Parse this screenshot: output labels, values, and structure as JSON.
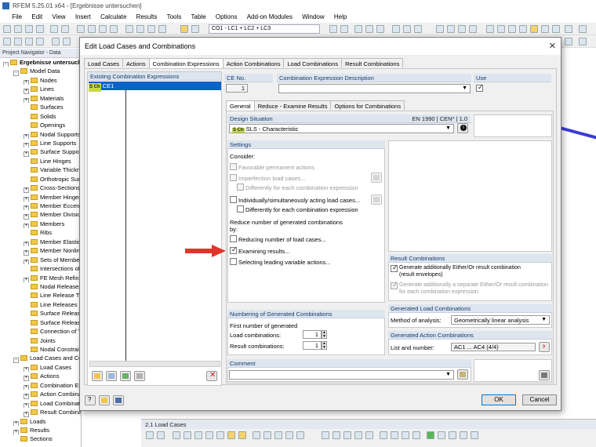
{
  "app": {
    "title": "RFEM 5.25.01 x64 - [Ergebnisse untersuchen]"
  },
  "menu": [
    "File",
    "Edit",
    "View",
    "Insert",
    "Calculate",
    "Results",
    "Tools",
    "Table",
    "Options",
    "Add-on Modules",
    "Window",
    "Help"
  ],
  "toolbar": {
    "combo_value": "CO1 - LC1 + LC2 + LC3"
  },
  "navigator": {
    "title": "Project Navigator - Data",
    "items": [
      "Ergebnisse untersuchen",
      "Model Data",
      "Nodes",
      "Lines",
      "Materials",
      "Surfaces",
      "Solids",
      "Openings",
      "Nodal Supports",
      "Line Supports",
      "Surface Supports",
      "Line Hinges",
      "Variable Thickness",
      "Orthotropic Surfaces",
      "Cross-Sections",
      "Member Hinges",
      "Member Eccentricities",
      "Member Divisions",
      "Members",
      "Ribs",
      "Member Elastic Foundations",
      "Member Nonlinearities",
      "Sets of Members",
      "Intersections of Surfaces",
      "FE Mesh Refinements",
      "Nodal Releases",
      "Line Release Types",
      "Line Releases",
      "Surface Release Types",
      "Surface Releases",
      "Connection of Two Members",
      "Joints",
      "Nodal Constraints",
      "Load Cases and Combinations",
      "Load Cases",
      "Actions",
      "Combination Expressions",
      "Action Combinations",
      "Load Combinations",
      "Result Combinations",
      "Loads",
      "Results",
      "Sections"
    ]
  },
  "bottom_panel": {
    "title": "2.1 Load Cases"
  },
  "dialog": {
    "title": "Edit Load Cases and Combinations",
    "tabs": [
      "Load Cases",
      "Actions",
      "Combination Expressions",
      "Action Combinations",
      "Load Combinations",
      "Result Combinations"
    ],
    "existing": {
      "title": "Existing Combination Expressions",
      "items": [
        {
          "code": "S Ch",
          "name": "CE1"
        }
      ]
    },
    "ce_no": {
      "label": "CE No.",
      "value": "1"
    },
    "description": {
      "label": "Combination Expression Description",
      "value": ""
    },
    "use": {
      "label": "Use"
    },
    "subtabs": [
      "General",
      "Reduce - Examine Results",
      "Options for Combinations"
    ],
    "design_situation": {
      "label": "Design Situation",
      "norm": "EN 1990 | CEN* | 1.0",
      "code": "S Ch",
      "value": "SLS - Characteristic"
    },
    "settings": {
      "title": "Settings",
      "consider": "Consider:",
      "favorable": "Favorable permanent actions",
      "imperfection": "Imperfection load cases...",
      "diff1": "Differently for each combination expression",
      "individually": "Individually/simultaneously acting load cases...",
      "diff2": "Differently for each combination expression",
      "reduce_label_1": "Reduce number of generated combinations",
      "reduce_label_2": "by:",
      "reducing": "Reducing number of load cases...",
      "examining": "Examining results...",
      "selecting": "Selecting leading variable actions..."
    },
    "numbering": {
      "title": "Numbering of Generated Combinations",
      "first": "First number of generated",
      "load_label": "Load combinations:",
      "load_value": "1",
      "result_label": "Result combinations:",
      "result_value": "1"
    },
    "result_combinations": {
      "title": "Result Combinations",
      "opt1_line1": "Generate additionally Either/Or result combination",
      "opt1_line2": "(result envelopes)",
      "opt2_line1": "Generate additionally a separate Either/Or result combination",
      "opt2_line2": "for each combination expression"
    },
    "generated_lc": {
      "title": "Generated Load Combinations",
      "method_label": "Method of analysis:",
      "method_value": "Geometrically linear analysis"
    },
    "generated_ac": {
      "title": "Generated Action Combinations",
      "list_label": "List and number:",
      "list_value": "AC1 ... AC4 (4/4)"
    },
    "comment": {
      "title": "Comment",
      "value": ""
    },
    "buttons": {
      "ok": "OK",
      "cancel": "Cancel"
    }
  },
  "colors": {
    "accent_red": "#e0352b",
    "group_header": "#dde5ef",
    "selection": "#0a64c8"
  }
}
